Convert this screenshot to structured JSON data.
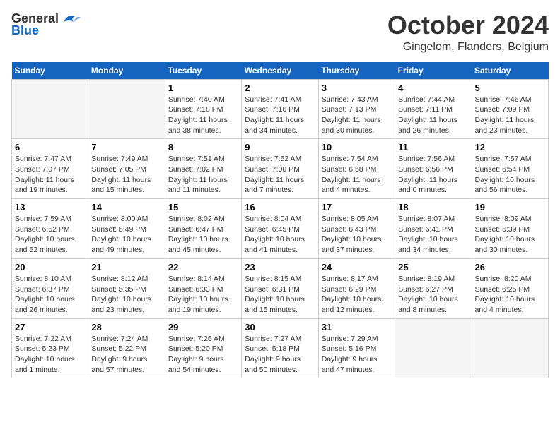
{
  "header": {
    "logo_general": "General",
    "logo_blue": "Blue",
    "month_title": "October 2024",
    "location": "Gingelom, Flanders, Belgium"
  },
  "days_of_week": [
    "Sunday",
    "Monday",
    "Tuesday",
    "Wednesday",
    "Thursday",
    "Friday",
    "Saturday"
  ],
  "weeks": [
    [
      {
        "num": "",
        "info": ""
      },
      {
        "num": "",
        "info": ""
      },
      {
        "num": "1",
        "info": "Sunrise: 7:40 AM\nSunset: 7:18 PM\nDaylight: 11 hours\nand 38 minutes."
      },
      {
        "num": "2",
        "info": "Sunrise: 7:41 AM\nSunset: 7:16 PM\nDaylight: 11 hours\nand 34 minutes."
      },
      {
        "num": "3",
        "info": "Sunrise: 7:43 AM\nSunset: 7:13 PM\nDaylight: 11 hours\nand 30 minutes."
      },
      {
        "num": "4",
        "info": "Sunrise: 7:44 AM\nSunset: 7:11 PM\nDaylight: 11 hours\nand 26 minutes."
      },
      {
        "num": "5",
        "info": "Sunrise: 7:46 AM\nSunset: 7:09 PM\nDaylight: 11 hours\nand 23 minutes."
      }
    ],
    [
      {
        "num": "6",
        "info": "Sunrise: 7:47 AM\nSunset: 7:07 PM\nDaylight: 11 hours\nand 19 minutes."
      },
      {
        "num": "7",
        "info": "Sunrise: 7:49 AM\nSunset: 7:05 PM\nDaylight: 11 hours\nand 15 minutes."
      },
      {
        "num": "8",
        "info": "Sunrise: 7:51 AM\nSunset: 7:02 PM\nDaylight: 11 hours\nand 11 minutes."
      },
      {
        "num": "9",
        "info": "Sunrise: 7:52 AM\nSunset: 7:00 PM\nDaylight: 11 hours\nand 7 minutes."
      },
      {
        "num": "10",
        "info": "Sunrise: 7:54 AM\nSunset: 6:58 PM\nDaylight: 11 hours\nand 4 minutes."
      },
      {
        "num": "11",
        "info": "Sunrise: 7:56 AM\nSunset: 6:56 PM\nDaylight: 11 hours\nand 0 minutes."
      },
      {
        "num": "12",
        "info": "Sunrise: 7:57 AM\nSunset: 6:54 PM\nDaylight: 10 hours\nand 56 minutes."
      }
    ],
    [
      {
        "num": "13",
        "info": "Sunrise: 7:59 AM\nSunset: 6:52 PM\nDaylight: 10 hours\nand 52 minutes."
      },
      {
        "num": "14",
        "info": "Sunrise: 8:00 AM\nSunset: 6:49 PM\nDaylight: 10 hours\nand 49 minutes."
      },
      {
        "num": "15",
        "info": "Sunrise: 8:02 AM\nSunset: 6:47 PM\nDaylight: 10 hours\nand 45 minutes."
      },
      {
        "num": "16",
        "info": "Sunrise: 8:04 AM\nSunset: 6:45 PM\nDaylight: 10 hours\nand 41 minutes."
      },
      {
        "num": "17",
        "info": "Sunrise: 8:05 AM\nSunset: 6:43 PM\nDaylight: 10 hours\nand 37 minutes."
      },
      {
        "num": "18",
        "info": "Sunrise: 8:07 AM\nSunset: 6:41 PM\nDaylight: 10 hours\nand 34 minutes."
      },
      {
        "num": "19",
        "info": "Sunrise: 8:09 AM\nSunset: 6:39 PM\nDaylight: 10 hours\nand 30 minutes."
      }
    ],
    [
      {
        "num": "20",
        "info": "Sunrise: 8:10 AM\nSunset: 6:37 PM\nDaylight: 10 hours\nand 26 minutes."
      },
      {
        "num": "21",
        "info": "Sunrise: 8:12 AM\nSunset: 6:35 PM\nDaylight: 10 hours\nand 23 minutes."
      },
      {
        "num": "22",
        "info": "Sunrise: 8:14 AM\nSunset: 6:33 PM\nDaylight: 10 hours\nand 19 minutes."
      },
      {
        "num": "23",
        "info": "Sunrise: 8:15 AM\nSunset: 6:31 PM\nDaylight: 10 hours\nand 15 minutes."
      },
      {
        "num": "24",
        "info": "Sunrise: 8:17 AM\nSunset: 6:29 PM\nDaylight: 10 hours\nand 12 minutes."
      },
      {
        "num": "25",
        "info": "Sunrise: 8:19 AM\nSunset: 6:27 PM\nDaylight: 10 hours\nand 8 minutes."
      },
      {
        "num": "26",
        "info": "Sunrise: 8:20 AM\nSunset: 6:25 PM\nDaylight: 10 hours\nand 4 minutes."
      }
    ],
    [
      {
        "num": "27",
        "info": "Sunrise: 7:22 AM\nSunset: 5:23 PM\nDaylight: 10 hours\nand 1 minute."
      },
      {
        "num": "28",
        "info": "Sunrise: 7:24 AM\nSunset: 5:22 PM\nDaylight: 9 hours\nand 57 minutes."
      },
      {
        "num": "29",
        "info": "Sunrise: 7:26 AM\nSunset: 5:20 PM\nDaylight: 9 hours\nand 54 minutes."
      },
      {
        "num": "30",
        "info": "Sunrise: 7:27 AM\nSunset: 5:18 PM\nDaylight: 9 hours\nand 50 minutes."
      },
      {
        "num": "31",
        "info": "Sunrise: 7:29 AM\nSunset: 5:16 PM\nDaylight: 9 hours\nand 47 minutes."
      },
      {
        "num": "",
        "info": ""
      },
      {
        "num": "",
        "info": ""
      }
    ]
  ]
}
